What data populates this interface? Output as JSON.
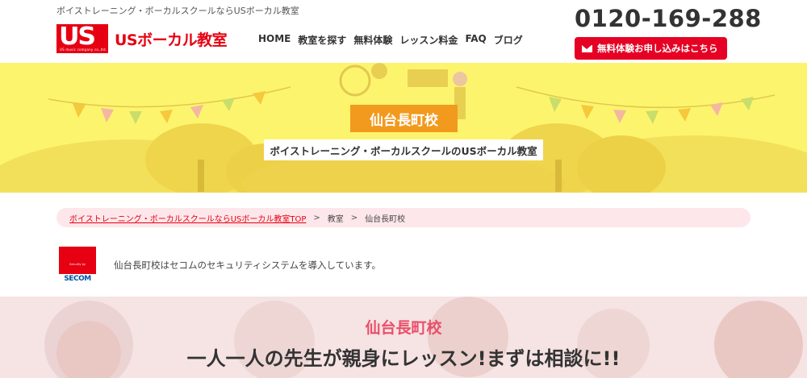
{
  "header": {
    "tagline": "ボイストレーニング・ボーカルスクールならUSボーカル教室",
    "logo_mark": "US",
    "logo_sub": "US music company co.,ltd.",
    "logo_text": "USボーカル教室",
    "phone": "0120-169-288",
    "cta_label": "無料体験お申し込みはこちら",
    "nav": [
      "HOME",
      "教室を探す",
      "無料体験",
      "レッスン料金",
      "FAQ",
      "ブログ"
    ]
  },
  "hero": {
    "title": "仙台長町校",
    "subtitle": "ボイストレーニング・ボーカルスクールのUSボーカル教室"
  },
  "breadcrumb": {
    "home_link": "ボイストレーニング・ボーカルスクールならUSボーカル教室TOP",
    "separator": ">",
    "level2": "教室",
    "current": "仙台長町校"
  },
  "security": {
    "logo_small": "Security by",
    "logo_brand": "SECOM",
    "text": "仙台長町校はセコムのセキュリティシステムを導入しています。"
  },
  "intro": {
    "title": "仙台長町校",
    "headline": "一人一人の先生が親身にレッスン!まずは相談に!!"
  },
  "colors": {
    "brand_red": "#e60012",
    "hero_yellow": "#fdf46e",
    "title_orange": "#f29a1d",
    "breadcrumb_bg": "#fde7ea",
    "section_pink": "#e8506b"
  }
}
